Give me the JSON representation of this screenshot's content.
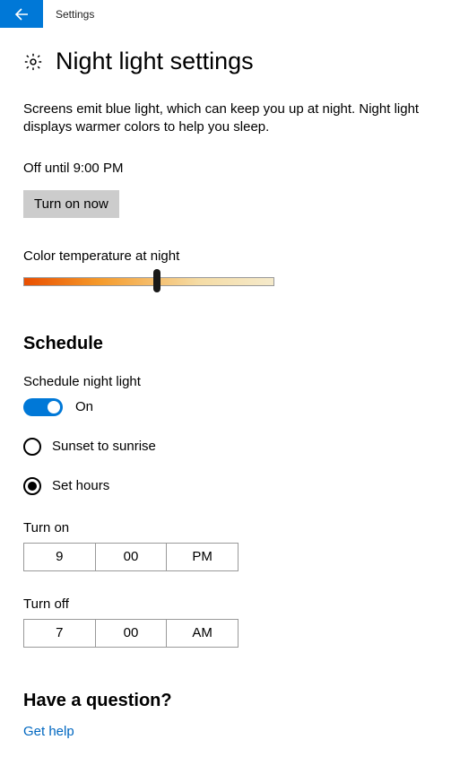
{
  "app_title": "Settings",
  "page_title": "Night light settings",
  "description": "Screens emit blue light, which can keep you up at night. Night light displays warmer colors to help you sleep.",
  "status_line": "Off until 9:00 PM",
  "turn_on_button": "Turn on now",
  "color_temp_label": "Color temperature at night",
  "schedule": {
    "heading": "Schedule",
    "toggle_label": "Schedule night light",
    "toggle_state": "On",
    "options": {
      "sunset": "Sunset to sunrise",
      "set_hours": "Set hours"
    },
    "turn_on": {
      "label": "Turn on",
      "hour": "9",
      "minute": "00",
      "ampm": "PM"
    },
    "turn_off": {
      "label": "Turn off",
      "hour": "7",
      "minute": "00",
      "ampm": "AM"
    }
  },
  "help": {
    "heading": "Have a question?",
    "link": "Get help"
  }
}
